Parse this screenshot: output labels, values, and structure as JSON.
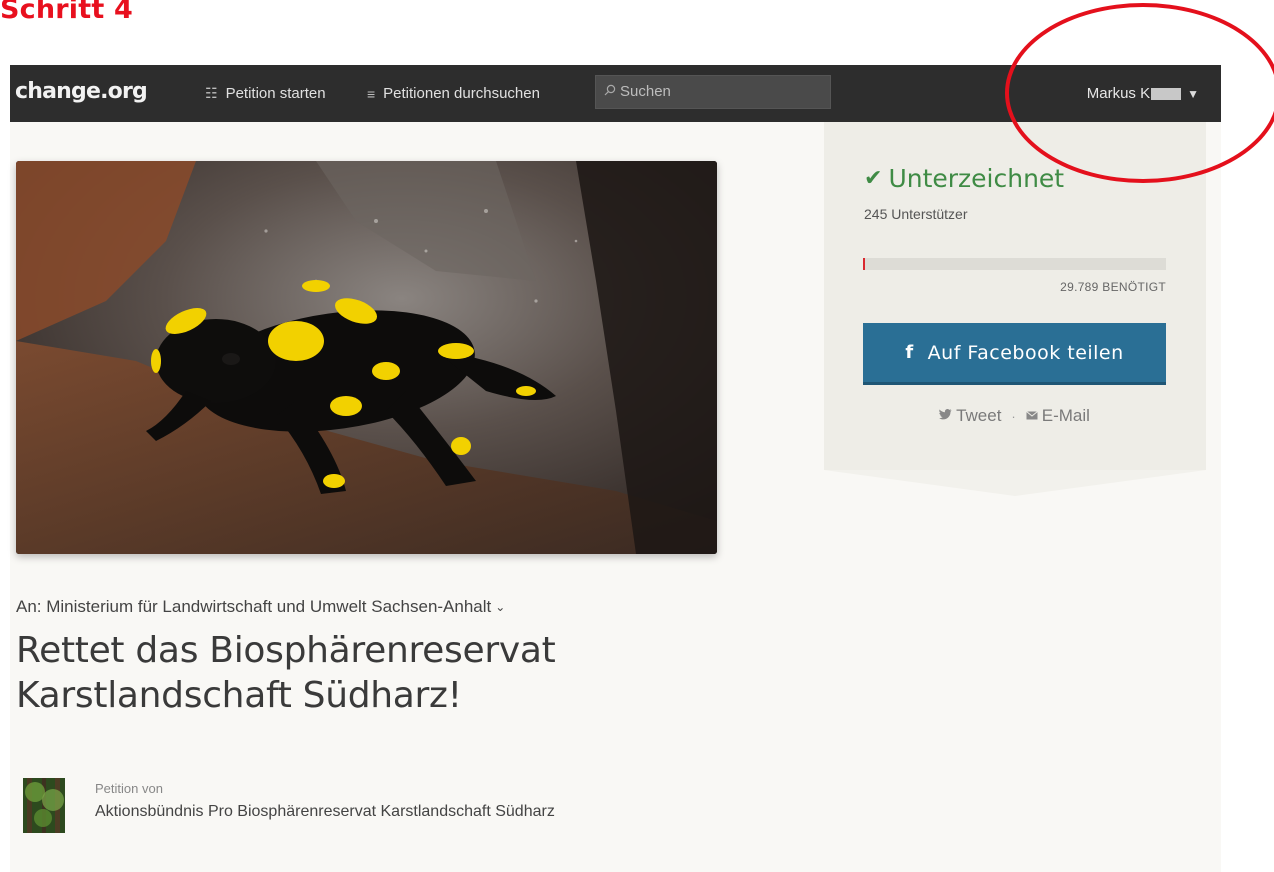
{
  "annotation": {
    "step_label": "Schritt 4",
    "circle_color": "#e4101c"
  },
  "navbar": {
    "logo": "change.org",
    "start_petition": "Petition starten",
    "browse_petitions": "Petitionen durchsuchen",
    "search_placeholder": "Suchen",
    "user_name": "Markus K",
    "start_icon": "document-icon",
    "browse_icon": "list-icon",
    "search_icon": "search-icon",
    "user_icon": "caret-down-icon"
  },
  "sidebar": {
    "status": "Unterzeichnet",
    "supporters": "245 Unterstützer",
    "progress_fraction": 0.008,
    "needed": "29.789 BENÖTIGT",
    "facebook_button": "Auf Facebook teilen",
    "tweet": "Tweet",
    "separator": "·",
    "email": "E-Mail",
    "accent_green": "#3f8b45",
    "facebook_blue": "#2a6f95",
    "progress_red": "#d9282f"
  },
  "petition": {
    "target": "An: Ministerium für Landwirtschaft und Umwelt Sachsen-Anhalt",
    "title": "Rettet das Biosphärenreservat Karstlandschaft Südharz!",
    "by_label": "Petition von",
    "author": "Aktionsbündnis Pro Biosphärenreservat Karstlandschaft Südharz"
  }
}
